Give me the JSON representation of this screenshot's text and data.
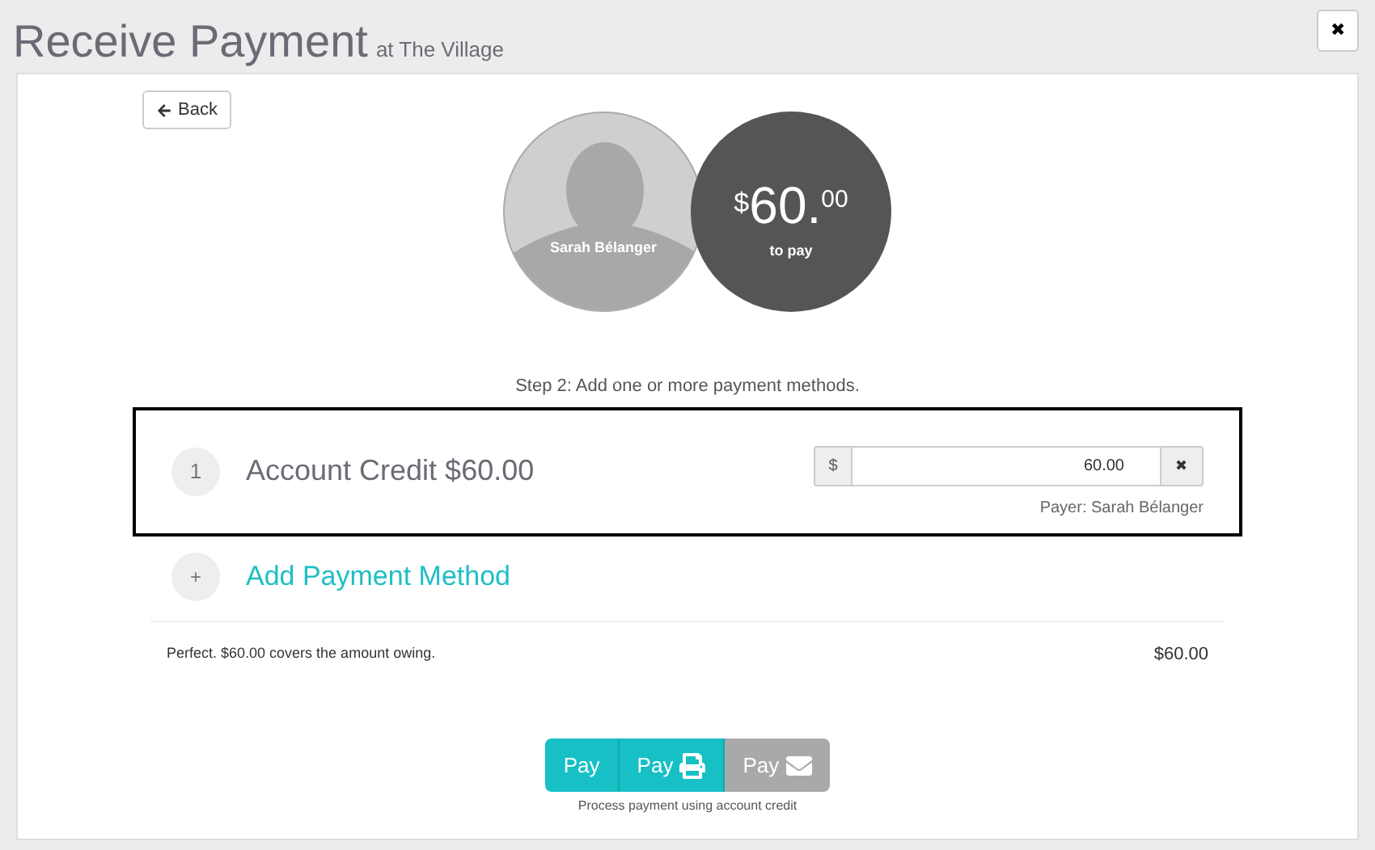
{
  "header": {
    "title": "Receive Payment",
    "subtitle": "at The Village",
    "close": "✖"
  },
  "back": {
    "label": "Back"
  },
  "payer": {
    "name": "Sarah Bélanger"
  },
  "due": {
    "currency": "$",
    "whole": "60.",
    "cents": "00",
    "caption": "to pay"
  },
  "step": "Step 2: Add one or more payment methods.",
  "methods": [
    {
      "number": "1",
      "name": "Account Credit $60.00",
      "currency": "$",
      "amount": "60.00",
      "remove": "✖",
      "payer": "Payer: Sarah Bélanger",
      "selected": true
    }
  ],
  "add_method": {
    "icon": "+",
    "label": "Add Payment Method"
  },
  "summary": {
    "message": "Perfect. $60.00 covers the amount owing.",
    "total": "$60.00"
  },
  "pay_buttons": [
    {
      "label": "Pay",
      "kind": "plain",
      "disabled": false
    },
    {
      "label": "Pay",
      "kind": "print",
      "disabled": false
    },
    {
      "label": "Pay",
      "kind": "email",
      "disabled": true
    }
  ],
  "pay_caption": "Process payment using account credit"
}
